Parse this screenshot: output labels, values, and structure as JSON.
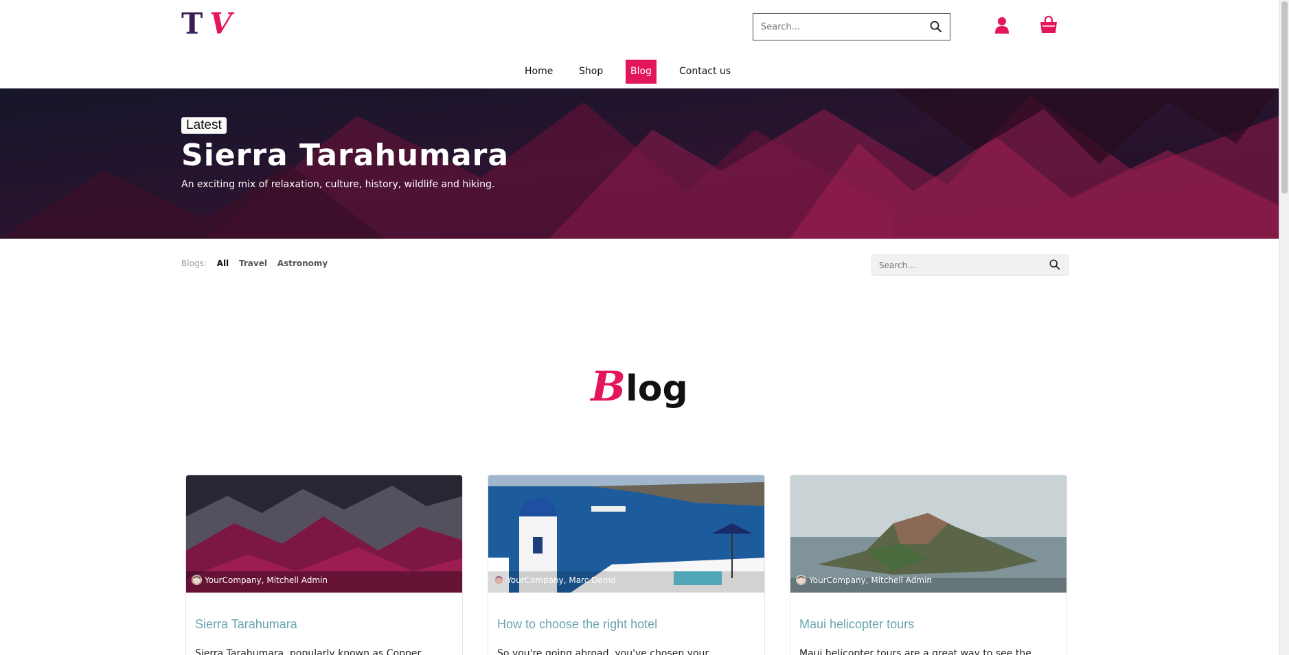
{
  "header": {
    "logo": {
      "first": "T",
      "second": "V"
    },
    "search": {
      "placeholder": "Search..."
    },
    "icons": {
      "search": "search-icon",
      "user": "user-icon",
      "cart": "shopping-bag-icon"
    },
    "nav": [
      {
        "label": "Home",
        "active": false
      },
      {
        "label": "Shop",
        "active": false
      },
      {
        "label": "Blog",
        "active": true
      },
      {
        "label": "Contact us",
        "active": false
      }
    ]
  },
  "hero": {
    "badge": "Latest",
    "title": "Sierra Tarahumara",
    "subtitle": "An exciting mix of relaxation, culture, history, wildlife and hiking."
  },
  "filters": {
    "label": "Blogs:",
    "items": [
      "All",
      "Travel",
      "Astronomy"
    ],
    "active": "All",
    "search_placeholder": "Search..."
  },
  "heading": {
    "cap": "B",
    "rest": "log"
  },
  "posts": [
    {
      "author": "YourCompany, Mitchell Admin",
      "title": "Sierra Tarahumara",
      "excerpt": "Sierra Tarahumara, popularly known as Copper"
    },
    {
      "author": "YourCompany, Marc Demo",
      "title": "How to choose the right hotel",
      "excerpt": "So you're going abroad, you've chosen your"
    },
    {
      "author": "YourCompany, Mitchell Admin",
      "title": "Maui helicopter tours",
      "excerpt": "Maui helicopter tours are a great way to see the"
    }
  ],
  "colors": {
    "accent": "#e3165b",
    "logo_dark": "#3b1d57",
    "post_title": "#6aa4b0"
  }
}
